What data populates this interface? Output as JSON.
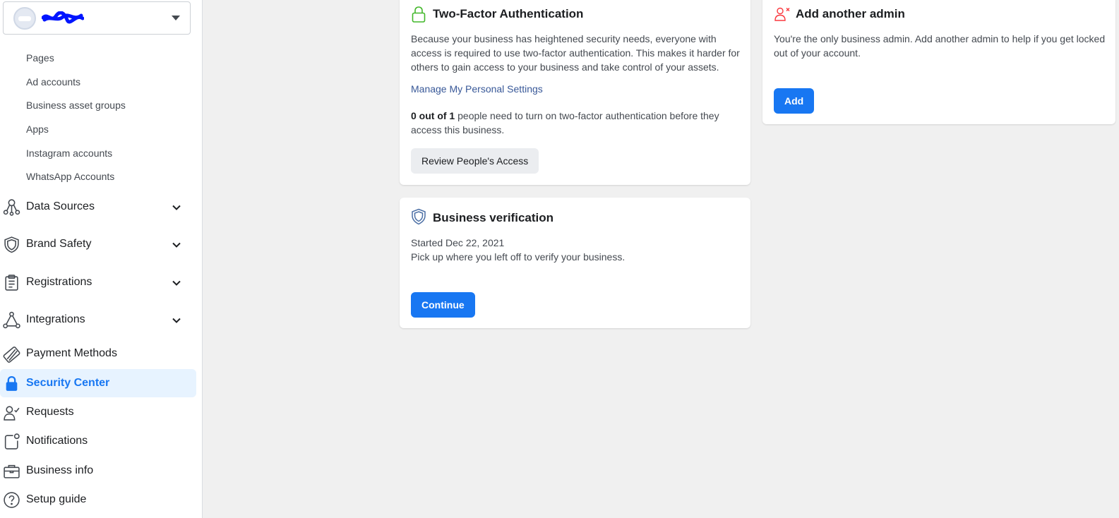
{
  "sidebar": {
    "account_name_redacted": true,
    "sub_items": [
      {
        "label": "Pages"
      },
      {
        "label": "Ad accounts"
      },
      {
        "label": "Business asset groups"
      },
      {
        "label": "Apps"
      },
      {
        "label": "Instagram accounts"
      },
      {
        "label": "WhatsApp Accounts"
      }
    ],
    "nav": {
      "data_sources": "Data Sources",
      "brand_safety": "Brand Safety",
      "registrations": "Registrations",
      "integrations": "Integrations",
      "payment_methods": "Payment Methods",
      "security_center": "Security Center",
      "requests": "Requests",
      "notifications": "Notifications",
      "business_info": "Business info",
      "setup_guide": "Setup guide"
    },
    "active_item": "Security Center"
  },
  "two_factor": {
    "title": "Two-Factor Authentication",
    "description": "Because your business has heightened security needs, everyone with access is required to use two-factor authentication. This makes it harder for others to gain access to your business and take control of your assets.",
    "link": "Manage My Personal Settings",
    "count_bold": "0 out of 1",
    "count_rest": " people need to turn on two-factor authentication before they access this business.",
    "button": "Review People's Access"
  },
  "verification": {
    "title": "Business verification",
    "started": "Started Dec 22, 2021",
    "description": "Pick up where you left off to verify your business.",
    "button": "Continue"
  },
  "admin": {
    "title": "Add another admin",
    "description": "You're the only business admin. Add another admin to help if you get locked out of your account.",
    "button": "Add"
  },
  "colors": {
    "accent": "#1877f2",
    "active_bg": "#e7f3ff",
    "lock_green": "#42b72a",
    "admin_red": "#fa383e",
    "shield_blue": "#4b6fa5"
  }
}
